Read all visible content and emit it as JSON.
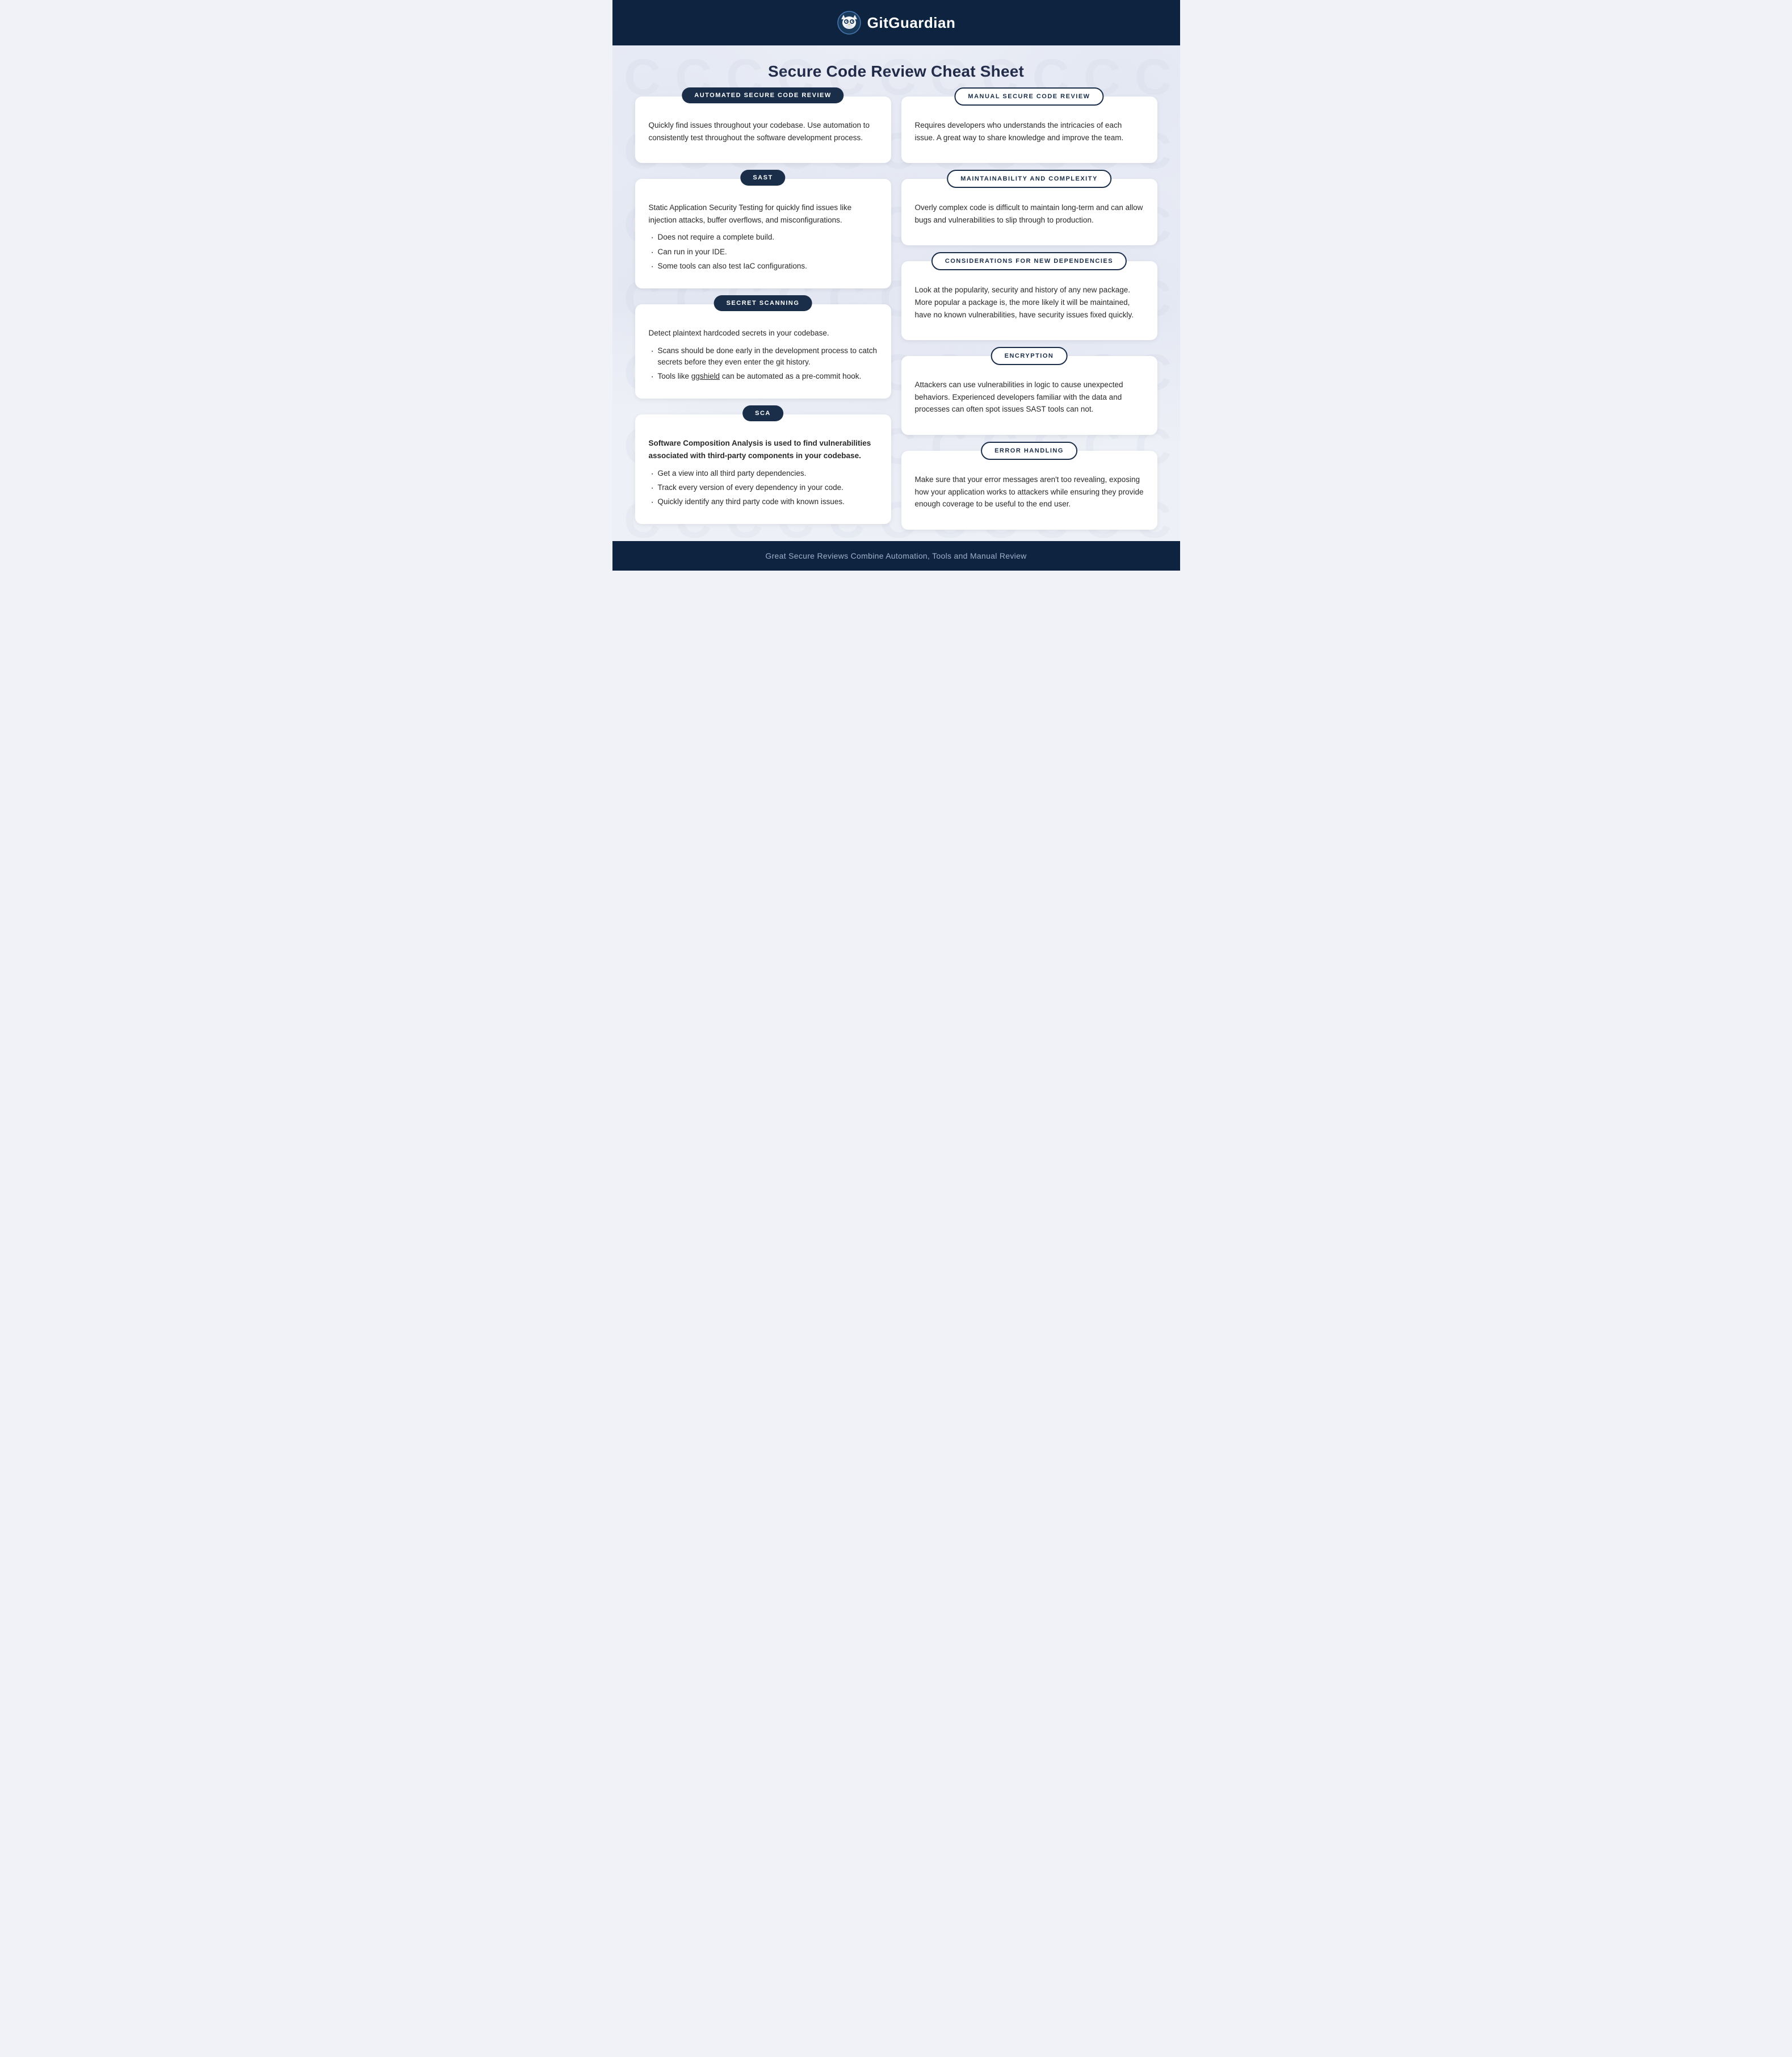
{
  "header": {
    "brand": "GitGuardian"
  },
  "page": {
    "title": "Secure Code Review Cheat Sheet"
  },
  "left_column": [
    {
      "badge_text": "AUTOMATED SECURE CODE REVIEW",
      "badge_style": "dark",
      "body_text": "Quickly find issues throughout your codebase. Use automation to consistently test throughout the software development process.",
      "bullet_points": []
    },
    {
      "badge_text": "SAST",
      "badge_style": "dark",
      "intro": "Static Application Security Testing for quickly find issues like injection attacks, buffer overflows, and misconfigurations.",
      "bullet_points": [
        "Does not require a complete build.",
        "Can run in your IDE.",
        "Some tools can also test IaC configurations."
      ]
    },
    {
      "badge_text": "SECRET SCANNING",
      "badge_style": "dark",
      "intro": "Detect plaintext hardcoded secrets in your codebase.",
      "bullet_points": [
        "Scans should be done early in the development process to catch secrets before they even enter the git history.",
        "Tools like ggshield can be automated as a pre-commit hook."
      ]
    },
    {
      "badge_text": "SCA",
      "badge_style": "dark",
      "intro_bold": "Software Composition Analysis is used to find vulnerabilities associated with third-party components in your codebase.",
      "bullet_points": [
        "Get a view into all third party dependencies.",
        "Track every version of every dependency in your code.",
        "Quickly identify any third party code with known issues."
      ]
    }
  ],
  "right_column": [
    {
      "badge_text": "MANUAL SECURE CODE REVIEW",
      "badge_style": "outline",
      "body_text": "Requires developers who understands the intricacies of each issue. A great way to share knowledge and improve the team.",
      "bullet_points": []
    },
    {
      "badge_text": "MAINTAINABILITY AND COMPLEXITY",
      "badge_style": "outline",
      "body_text": "Overly complex code is difficult to maintain long-term and can allow bugs and vulnerabilities to slip through to production.",
      "bullet_points": []
    },
    {
      "badge_text": "CONSIDERATIONS FOR NEW DEPENDENCIES",
      "badge_style": "outline",
      "body_text": "Look at the popularity, security and history of any new package. More popular a package is, the more likely it will be maintained, have no known vulnerabilities, have security issues fixed quickly.",
      "bullet_points": []
    },
    {
      "badge_text": "ENCRYPTION",
      "badge_style": "outline",
      "body_text": "Attackers can use vulnerabilities in logic to cause unexpected behaviors. Experienced developers familiar with the data and processes can often spot issues SAST tools can not.",
      "bullet_points": []
    },
    {
      "badge_text": "ERROR HANDLING",
      "badge_style": "outline",
      "body_text": "Make sure that your error messages aren't too revealing, exposing how your application works to attackers while ensuring they provide enough coverage to be useful to the end user.",
      "bullet_points": []
    }
  ],
  "footer": {
    "text": "Great Secure Reviews Combine Automation, Tools and Manual Review"
  }
}
